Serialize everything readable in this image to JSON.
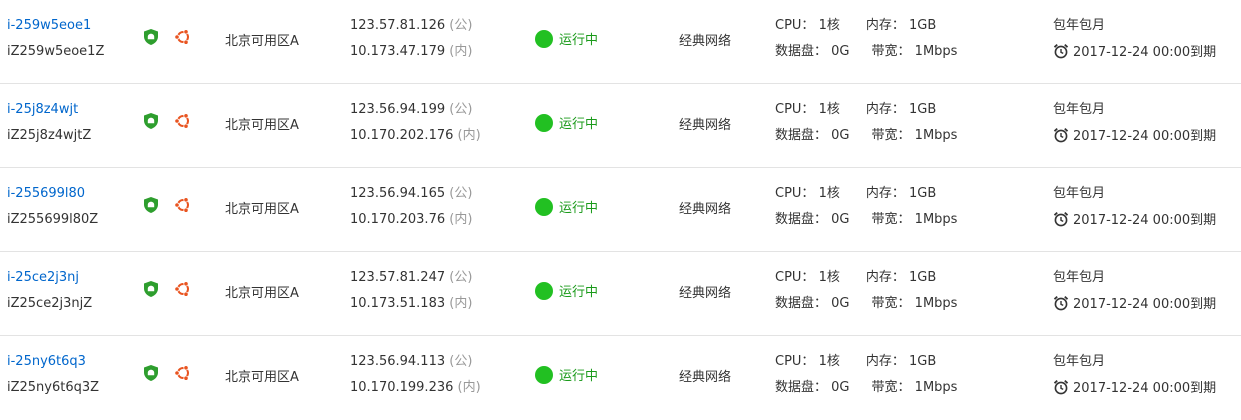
{
  "rows": [
    {
      "id": "i-259w5eoe1",
      "host": "iZ259w5eoe1Z",
      "zone": "北京可用区A",
      "public_ip": "123.57.81.126",
      "public_tag": "(公)",
      "private_ip": "10.173.47.179",
      "private_tag": "(内)",
      "status": "运行中",
      "network": "经典网络",
      "cpu_label": "CPU：",
      "cpu": "1核",
      "mem_label": "内存：",
      "mem": "1GB",
      "disk_label": "数据盘：",
      "disk": "0G",
      "bw_label": "带宽：",
      "bw": "1Mbps",
      "billing": "包年包月",
      "expire": "2017-12-24 00:00到期"
    },
    {
      "id": "i-25j8z4wjt",
      "host": "iZ25j8z4wjtZ",
      "zone": "北京可用区A",
      "public_ip": "123.56.94.199",
      "public_tag": "(公)",
      "private_ip": "10.170.202.176",
      "private_tag": "(内)",
      "status": "运行中",
      "network": "经典网络",
      "cpu_label": "CPU：",
      "cpu": "1核",
      "mem_label": "内存：",
      "mem": "1GB",
      "disk_label": "数据盘：",
      "disk": "0G",
      "bw_label": "带宽：",
      "bw": "1Mbps",
      "billing": "包年包月",
      "expire": "2017-12-24 00:00到期"
    },
    {
      "id": "i-255699l80",
      "host": "iZ255699l80Z",
      "zone": "北京可用区A",
      "public_ip": "123.56.94.165",
      "public_tag": "(公)",
      "private_ip": "10.170.203.76",
      "private_tag": "(内)",
      "status": "运行中",
      "network": "经典网络",
      "cpu_label": "CPU：",
      "cpu": "1核",
      "mem_label": "内存：",
      "mem": "1GB",
      "disk_label": "数据盘：",
      "disk": "0G",
      "bw_label": "带宽：",
      "bw": "1Mbps",
      "billing": "包年包月",
      "expire": "2017-12-24 00:00到期"
    },
    {
      "id": "i-25ce2j3nj",
      "host": "iZ25ce2j3njZ",
      "zone": "北京可用区A",
      "public_ip": "123.57.81.247",
      "public_tag": "(公)",
      "private_ip": "10.173.51.183",
      "private_tag": "(内)",
      "status": "运行中",
      "network": "经典网络",
      "cpu_label": "CPU：",
      "cpu": "1核",
      "mem_label": "内存：",
      "mem": "1GB",
      "disk_label": "数据盘：",
      "disk": "0G",
      "bw_label": "带宽：",
      "bw": "1Mbps",
      "billing": "包年包月",
      "expire": "2017-12-24 00:00到期"
    },
    {
      "id": "i-25ny6t6q3",
      "host": "iZ25ny6t6q3Z",
      "zone": "北京可用区A",
      "public_ip": "123.56.94.113",
      "public_tag": "(公)",
      "private_ip": "10.170.199.236",
      "private_tag": "(内)",
      "status": "运行中",
      "network": "经典网络",
      "cpu_label": "CPU：",
      "cpu": "1核",
      "mem_label": "内存：",
      "mem": "1GB",
      "disk_label": "数据盘：",
      "disk": "0G",
      "bw_label": "带宽：",
      "bw": "1Mbps",
      "billing": "包年包月",
      "expire": "2017-12-24 00:00到期"
    }
  ],
  "icons": {
    "security": "shield-icon",
    "os": "ubuntu-icon",
    "status": "status-dot",
    "expire": "alarm-clock-icon"
  },
  "colors": {
    "link": "#0066cc",
    "running": "#22c022",
    "shield": "#2e9e2e",
    "ubuntu": "#e95420",
    "muted": "#999999"
  }
}
